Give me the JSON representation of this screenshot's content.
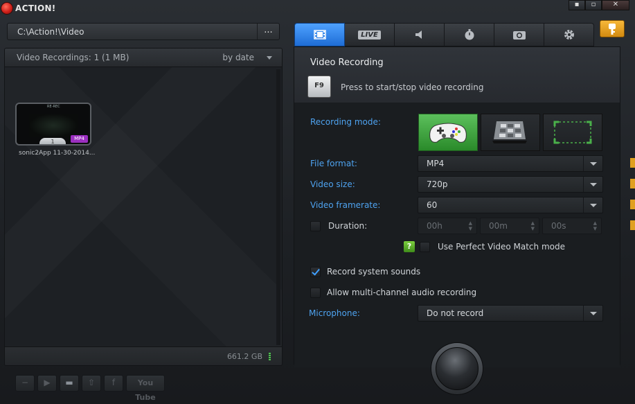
{
  "titlebar": {
    "title": "ACTION!",
    "minimize": "▪",
    "maximize": "▫",
    "close": "✕"
  },
  "pathbar": {
    "path": "C:\\Action!\\Video",
    "browse_label": "..."
  },
  "left_panel": {
    "title": "Video Recordings: 1 (1 MB)",
    "sort_label": "by date",
    "recordings": [
      {
        "name": "sonic2App 11-30-2014...",
        "count": "1",
        "format": "MP4",
        "preview_text": "RE-REC"
      }
    ],
    "disk_free": "661.2 GB"
  },
  "bottom_tools": {
    "minus": "−",
    "play": "▶",
    "folder": "▬",
    "upload": "⇧",
    "facebook": "f",
    "youtube": "You Tube"
  },
  "tabs": [
    {
      "name": "video",
      "active": true
    },
    {
      "name": "live",
      "label": "LIVE",
      "active": false
    },
    {
      "name": "audio",
      "active": false
    },
    {
      "name": "benchmark",
      "active": false
    },
    {
      "name": "screenshot",
      "active": false
    },
    {
      "name": "settings",
      "active": false
    }
  ],
  "video_recording": {
    "title": "Video Recording",
    "hotkey": "F9",
    "hotkey_desc": "Press to start/stop video recording",
    "recording_mode_label": "Recording mode:",
    "file_format_label": "File format:",
    "file_format": "MP4",
    "video_size_label": "Video size:",
    "video_size": "720p",
    "video_framerate_label": "Video framerate:",
    "video_framerate": "60",
    "duration_label": "Duration:",
    "duration_hours": "00h",
    "duration_minutes": "00m",
    "duration_seconds": "00s",
    "perfect_match_label": "Use Perfect Video Match mode",
    "help_label": "?",
    "record_system_sounds_label": "Record system sounds",
    "multichannel_label": "Allow multi-channel audio recording",
    "microphone_label": "Microphone:",
    "microphone": "Do not record"
  },
  "colors": {
    "accent_blue": "#2f86ee",
    "label_blue": "#4ea3f0",
    "mode_active_green": "#3fa63f",
    "brand_red": "#d0201a",
    "key_orange": "#e6a020"
  }
}
